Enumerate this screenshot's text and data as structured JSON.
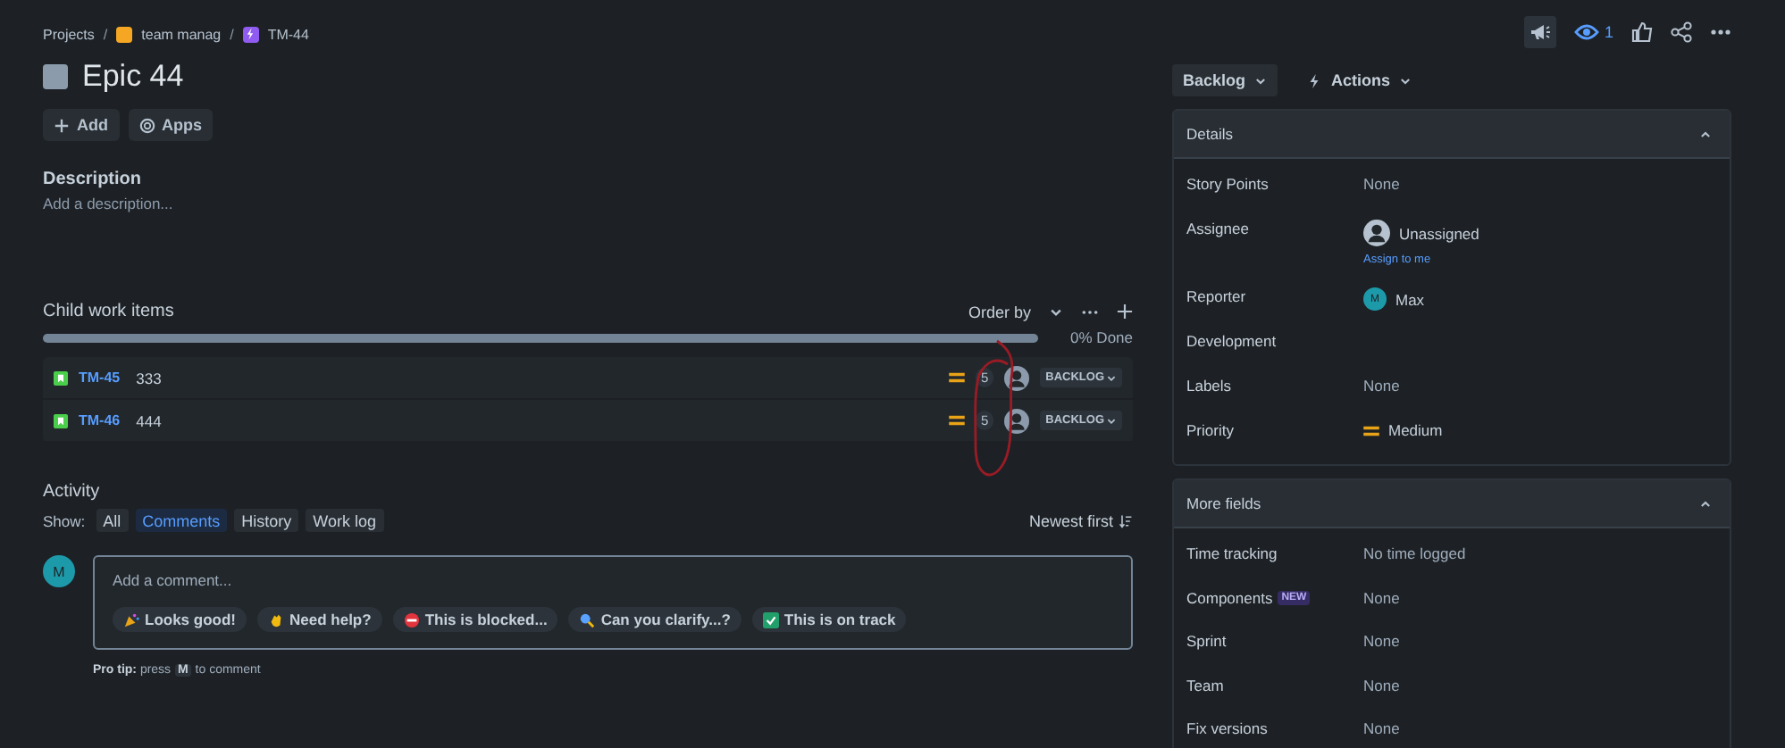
{
  "breadcrumbs": [
    {
      "label": "Projects",
      "kind": "text"
    },
    {
      "label": "team manag",
      "kind": "project"
    },
    {
      "label": "TM-44",
      "kind": "issue"
    }
  ],
  "breadcrumb_separator": "/",
  "title": "Epic 44",
  "watchers": "1",
  "buttons": [
    {
      "label": "Add",
      "kind": "add"
    },
    {
      "label": "Apps",
      "kind": "apps"
    }
  ],
  "description": {
    "heading": "Description",
    "placeholder": "Add a description..."
  },
  "child_items": {
    "heading": "Child work items",
    "order_by": "Order by",
    "progress": {
      "level": 0,
      "label": "0% Done"
    },
    "rows": [
      {
        "key": "TM-45",
        "summary": "333",
        "estimate": "5",
        "status": "BACKLOG"
      },
      {
        "key": "TM-46",
        "summary": "444",
        "estimate": "5",
        "status": "BACKLOG"
      }
    ]
  },
  "activity": {
    "heading": "Activity",
    "show_label": "Show:",
    "filters": [
      {
        "label": "All",
        "selected": false
      },
      {
        "label": "Comments",
        "selected": true
      },
      {
        "label": "History",
        "selected": false
      },
      {
        "label": "Work log",
        "selected": false
      }
    ],
    "sort": "Newest first",
    "avatar": "M",
    "comment_placeholder": "Add a comment...",
    "quick_replies": [
      {
        "label": "Looks good!",
        "kind": "party"
      },
      {
        "label": "Need help?",
        "kind": "wave"
      },
      {
        "label": "This is blocked...",
        "kind": "blocked"
      },
      {
        "label": "Can you clarify...?",
        "kind": "search"
      },
      {
        "label": "This is on track",
        "kind": "check"
      }
    ],
    "pro_tip": {
      "lead": "Pro tip:",
      "text": "press",
      "key": "M",
      "tail": "to comment"
    }
  },
  "status_button": "Backlog",
  "actions_button": "Actions",
  "details": {
    "title": "Details",
    "expanded": true,
    "fields": [
      {
        "label": "Story Points",
        "kind": "text",
        "value": "None"
      },
      {
        "label": "Assignee",
        "kind": "assignee",
        "value": "Unassigned",
        "link": "Assign to me"
      },
      {
        "label": "Reporter",
        "kind": "user",
        "avatar": "M",
        "value": "Max"
      },
      {
        "label": "Development",
        "kind": "empty"
      },
      {
        "label": "Labels",
        "kind": "text",
        "value": "None"
      },
      {
        "label": "Priority",
        "kind": "priority",
        "value": "Medium"
      }
    ]
  },
  "more_fields": {
    "title": "More fields",
    "expanded": true,
    "fields": [
      {
        "label": "Time tracking",
        "value": "No time logged"
      },
      {
        "label": "Components",
        "badge": "NEW",
        "value": "None"
      },
      {
        "label": "Sprint",
        "value": "None"
      },
      {
        "label": "Team",
        "value": "None"
      },
      {
        "label": "Fix versions",
        "value": "None"
      }
    ]
  }
}
